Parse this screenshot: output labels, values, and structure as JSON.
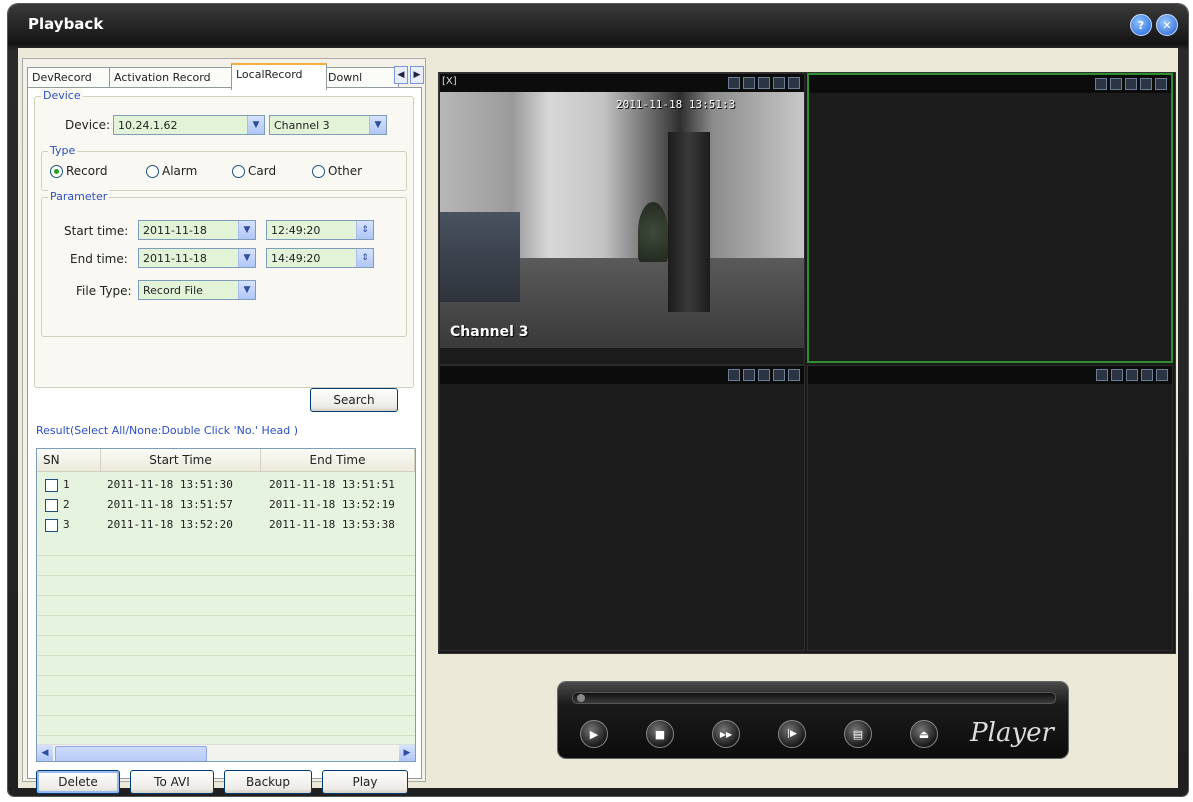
{
  "window": {
    "title": "Playback",
    "help_glyph": "?",
    "close_glyph": "✕"
  },
  "tabs": [
    {
      "label": "DevRecord"
    },
    {
      "label": "Activation Record"
    },
    {
      "label": "LocalRecord"
    },
    {
      "label": "Downl"
    }
  ],
  "tab_arrows": {
    "left": "◀",
    "right": "▶"
  },
  "device_group": {
    "label": "Device",
    "device_label": "Device:",
    "device_value": "10.24.1.62",
    "channel_value": "Channel 3"
  },
  "type_group": {
    "label": "Type",
    "options": [
      {
        "label": "Record",
        "selected": true
      },
      {
        "label": "Alarm",
        "selected": false
      },
      {
        "label": "Card",
        "selected": false
      },
      {
        "label": "Other",
        "selected": false
      }
    ]
  },
  "parameter_group": {
    "label": "Parameter",
    "start_label": "Start time:",
    "start_date": "2011-11-18",
    "start_time": "12:49:20",
    "end_label": "End time:",
    "end_date": "2011-11-18",
    "end_time": "14:49:20",
    "filetype_label": "File Type:",
    "filetype_value": "Record File"
  },
  "search_button": "Search",
  "result": {
    "label": "Result(Select All/None:Double Click 'No.' Head )",
    "columns": [
      "SN",
      "Start Time",
      "End Time"
    ],
    "rows": [
      {
        "sn": "1",
        "start": "2011-11-18 13:51:30",
        "end": "2011-11-18 13:51:51"
      },
      {
        "sn": "2",
        "start": "2011-11-18 13:51:57",
        "end": "2011-11-18 13:52:19"
      },
      {
        "sn": "3",
        "start": "2011-11-18 13:52:20",
        "end": "2011-11-18 13:53:38"
      }
    ]
  },
  "scroll_arrows": {
    "left": "◀",
    "right": "▶"
  },
  "actions": {
    "delete": "Delete",
    "to_avi": "To AVI",
    "backup": "Backup",
    "play": "Play"
  },
  "video": {
    "corner_text": "[X]",
    "timestamp": "2011-11-18 13:51:3",
    "channel_label": "Channel 3"
  },
  "player": {
    "logo": "Player",
    "buttons": [
      {
        "name": "play",
        "glyph": "▶"
      },
      {
        "name": "stop",
        "glyph": "■"
      },
      {
        "name": "fast-forward",
        "glyph": "▶▶"
      },
      {
        "name": "step-frame",
        "glyph": "|▶"
      },
      {
        "name": "snapshot",
        "glyph": "▤"
      },
      {
        "name": "eject",
        "glyph": "⏏"
      }
    ]
  }
}
